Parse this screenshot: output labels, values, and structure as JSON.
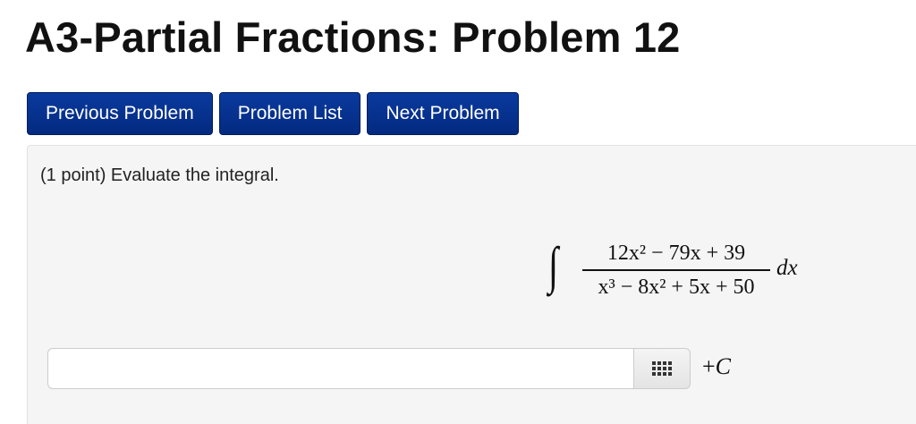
{
  "header": {
    "title": "A3-Partial Fractions: Problem 12"
  },
  "nav": {
    "previous_label": "Previous Problem",
    "list_label": "Problem List",
    "next_label": "Next Problem"
  },
  "problem": {
    "prompt": "(1 point) Evaluate the integral.",
    "integral_sign": "∫",
    "numerator": "12x² − 79x + 39",
    "denominator": "x³ − 8x² + 5x + 50",
    "differential": "dx"
  },
  "answer": {
    "value": "",
    "placeholder": "",
    "keypad_icon": "grid-icon",
    "suffix_plus": "+",
    "suffix_const": "C"
  },
  "colors": {
    "nav_button": "#032a80",
    "panel_background": "#f5f5f5"
  }
}
